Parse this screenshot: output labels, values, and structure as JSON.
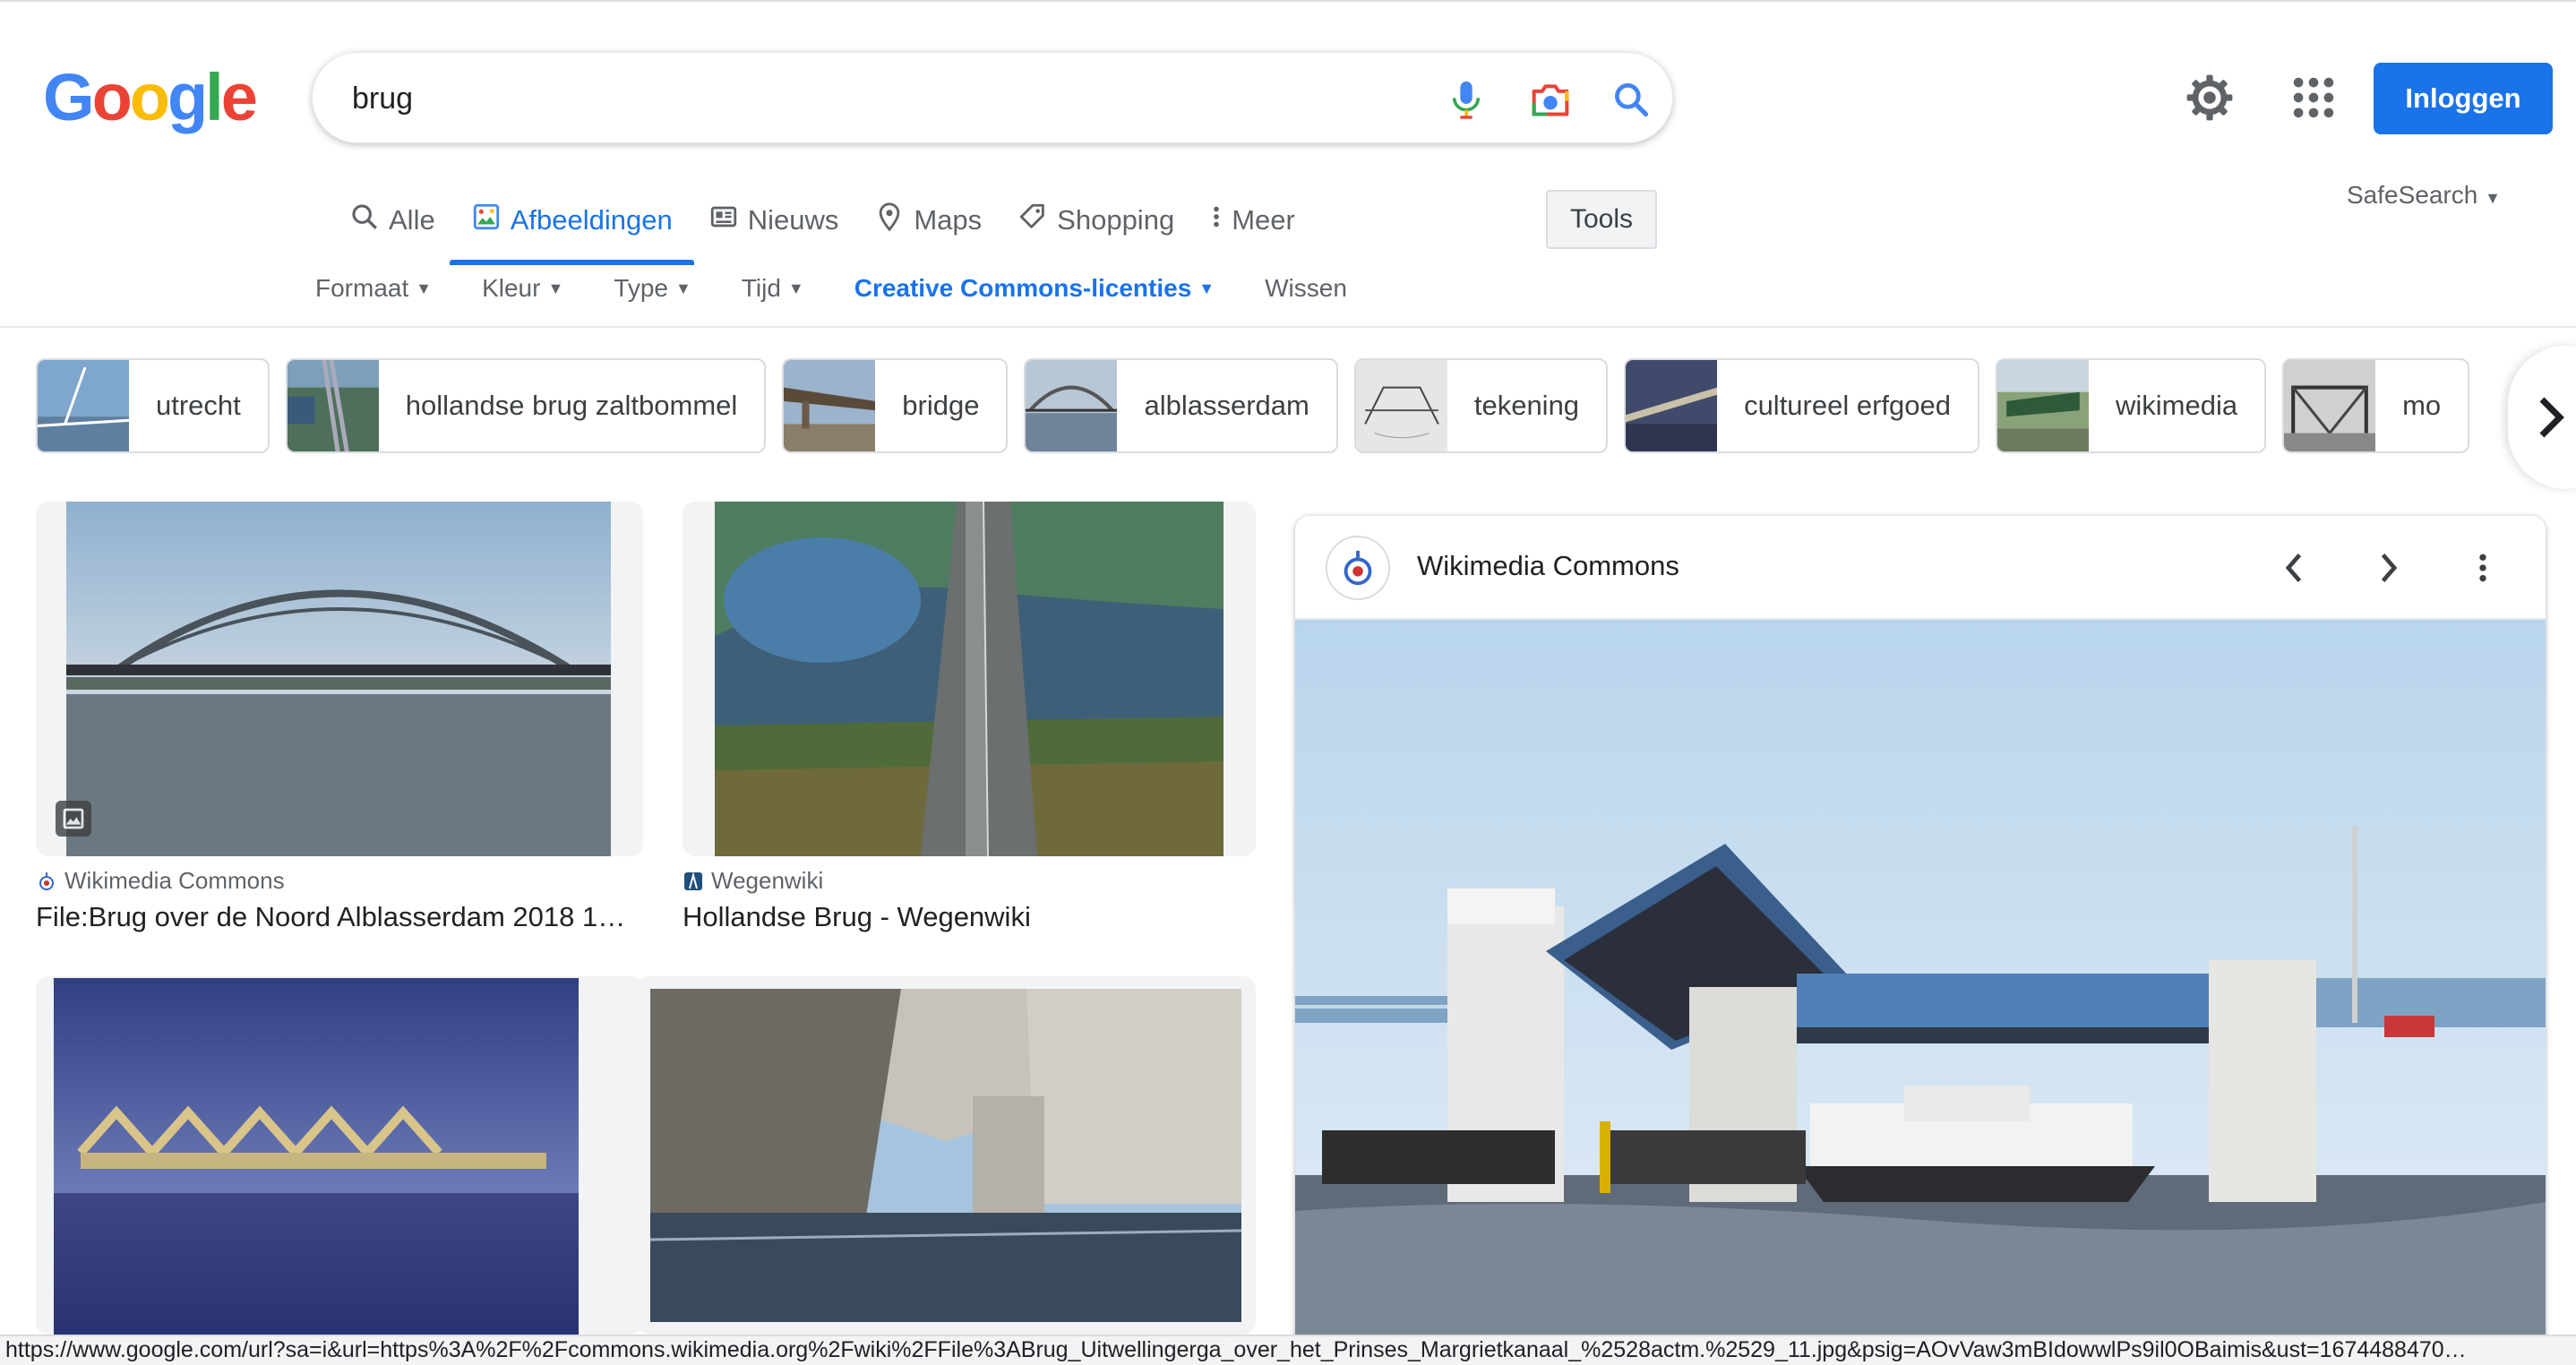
{
  "search": {
    "query": "brug"
  },
  "header": {
    "signin_label": "Inloggen",
    "safesearch_label": "SafeSearch"
  },
  "tabs": [
    {
      "label": "Alle",
      "icon": "search-icon"
    },
    {
      "label": "Afbeeldingen",
      "icon": "image-icon",
      "active": true
    },
    {
      "label": "Nieuws",
      "icon": "news-icon"
    },
    {
      "label": "Maps",
      "icon": "map-pin-icon"
    },
    {
      "label": "Shopping",
      "icon": "tag-icon"
    },
    {
      "label": "Meer",
      "icon": "more-vert-icon"
    }
  ],
  "tools_label": "Tools",
  "filters": [
    "Formaat",
    "Kleur",
    "Type",
    "Tijd",
    "Creative Commons-licenties",
    "Wissen"
  ],
  "chips": [
    "utrecht",
    "hollandse brug zaltbommel",
    "bridge",
    "alblasserdam",
    "tekening",
    "cultureel erfgoed",
    "wikimedia",
    "mo"
  ],
  "results": [
    {
      "source": "Wikimedia Commons",
      "title": "File:Brug over de Noord Alblasserdam 2018 1…"
    },
    {
      "source": "Wegenwiki",
      "title": "Hollandse Brug - Wegenwiki"
    },
    {
      "source": "",
      "title": ""
    },
    {
      "source": "",
      "title": ""
    }
  ],
  "panel": {
    "source": "Wikimedia Commons"
  },
  "status_url": "https://www.google.com/url?sa=i&url=https%3A%2F%2Fcommons.wikimedia.org%2Fwiki%2FFile%3ABrug_Uitwellingerga_over_het_Prinses_Margrietkanaal_%2528actm.%2529_11.jpg&psig=AOvVaw3mBIdowwlPs9il0OBaimis&ust=1674488470…",
  "colors": {
    "accent": "#1a73e8",
    "signin_bg": "#1a73e8"
  }
}
